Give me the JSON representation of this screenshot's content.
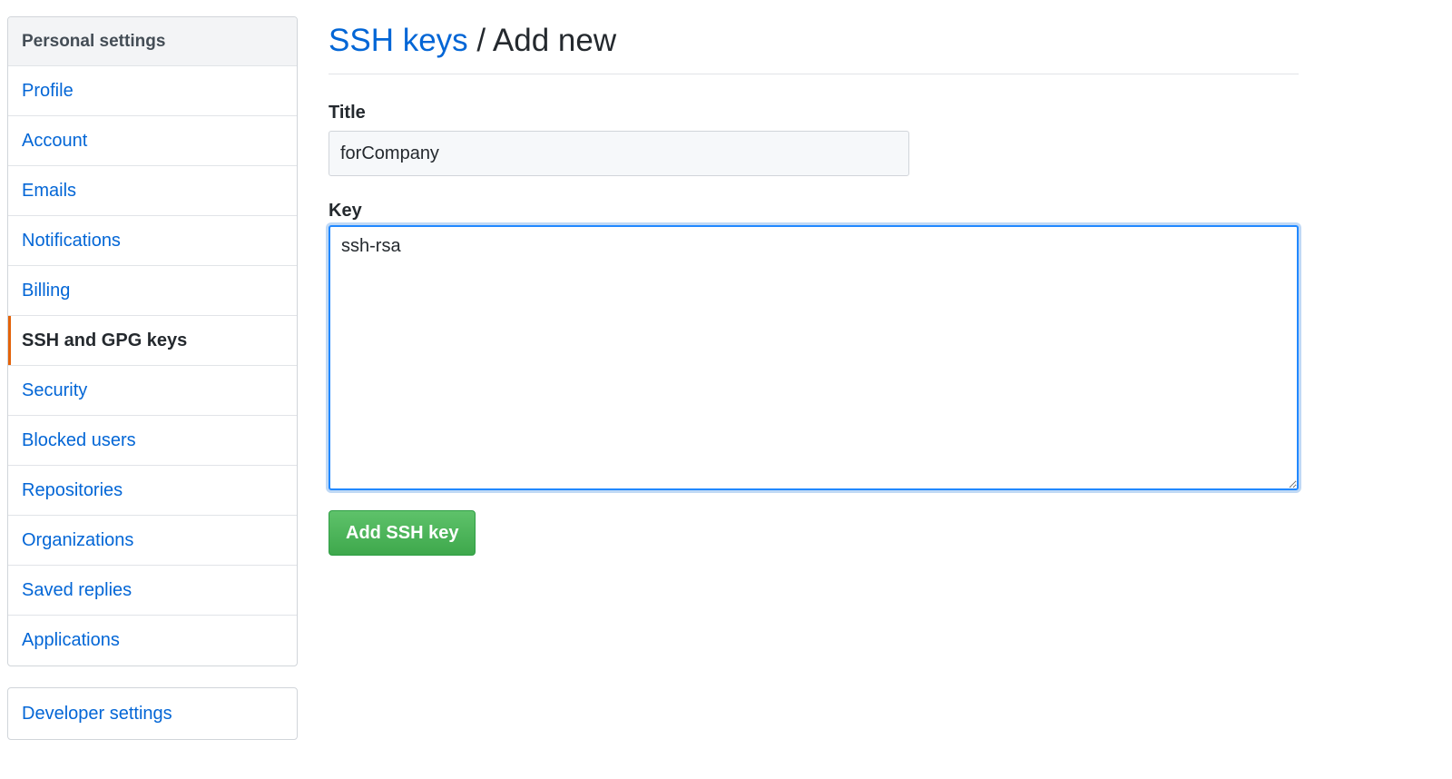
{
  "sidebar": {
    "heading": "Personal settings",
    "items": [
      {
        "label": "Profile"
      },
      {
        "label": "Account"
      },
      {
        "label": "Emails"
      },
      {
        "label": "Notifications"
      },
      {
        "label": "Billing"
      },
      {
        "label": "SSH and GPG keys",
        "selected": true
      },
      {
        "label": "Security"
      },
      {
        "label": "Blocked users"
      },
      {
        "label": "Repositories"
      },
      {
        "label": "Organizations"
      },
      {
        "label": "Saved replies"
      },
      {
        "label": "Applications"
      }
    ],
    "developer_settings_label": "Developer settings",
    "selected_accent_color": "#e36209"
  },
  "main": {
    "breadcrumb": {
      "link": "SSH keys",
      "separator": "/",
      "current": "Add new"
    },
    "title_field": {
      "label": "Title",
      "value": "forCompany"
    },
    "key_field": {
      "label": "Key",
      "value": "ssh-rsa "
    },
    "submit_label": "Add SSH key"
  },
  "colors": {
    "link": "#0366d6",
    "primary_button": "#3ea84c",
    "focus_ring": "#2188ff"
  }
}
